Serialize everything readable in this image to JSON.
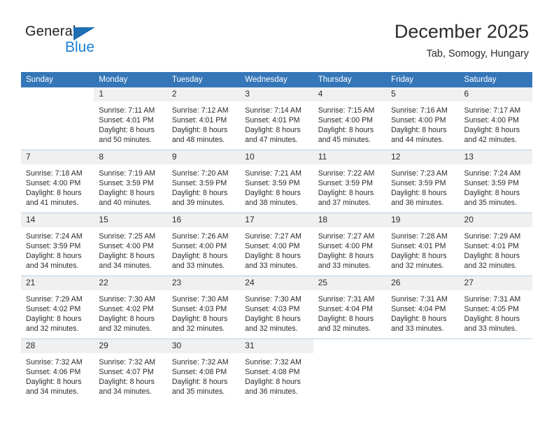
{
  "logo": {
    "word_one": "General",
    "word_two": "Blue",
    "triangle_icon": "blue-triangle-icon",
    "colors": {
      "word_one": "#231f20",
      "word_two": "#1a7fd4",
      "triangle": "#1f6fb5"
    }
  },
  "header": {
    "title": "December 2025",
    "subtitle": "Tab, Somogy, Hungary"
  },
  "theme": {
    "header_row_bg": "#3576b8",
    "header_row_text": "#ffffff",
    "daynum_bg": "#f0f0f0",
    "row_divider": "#b9cde0",
    "body_text": "#2b2b2b"
  },
  "calendar": {
    "weekday_headers": [
      "Sunday",
      "Monday",
      "Tuesday",
      "Wednesday",
      "Thursday",
      "Friday",
      "Saturday"
    ],
    "weeks": [
      [
        {
          "day": "",
          "lines": []
        },
        {
          "day": "1",
          "lines": [
            "Sunrise: 7:11 AM",
            "Sunset: 4:01 PM",
            "Daylight: 8 hours",
            "and 50 minutes."
          ]
        },
        {
          "day": "2",
          "lines": [
            "Sunrise: 7:12 AM",
            "Sunset: 4:01 PM",
            "Daylight: 8 hours",
            "and 48 minutes."
          ]
        },
        {
          "day": "3",
          "lines": [
            "Sunrise: 7:14 AM",
            "Sunset: 4:01 PM",
            "Daylight: 8 hours",
            "and 47 minutes."
          ]
        },
        {
          "day": "4",
          "lines": [
            "Sunrise: 7:15 AM",
            "Sunset: 4:00 PM",
            "Daylight: 8 hours",
            "and 45 minutes."
          ]
        },
        {
          "day": "5",
          "lines": [
            "Sunrise: 7:16 AM",
            "Sunset: 4:00 PM",
            "Daylight: 8 hours",
            "and 44 minutes."
          ]
        },
        {
          "day": "6",
          "lines": [
            "Sunrise: 7:17 AM",
            "Sunset: 4:00 PM",
            "Daylight: 8 hours",
            "and 42 minutes."
          ]
        }
      ],
      [
        {
          "day": "7",
          "lines": [
            "Sunrise: 7:18 AM",
            "Sunset: 4:00 PM",
            "Daylight: 8 hours",
            "and 41 minutes."
          ]
        },
        {
          "day": "8",
          "lines": [
            "Sunrise: 7:19 AM",
            "Sunset: 3:59 PM",
            "Daylight: 8 hours",
            "and 40 minutes."
          ]
        },
        {
          "day": "9",
          "lines": [
            "Sunrise: 7:20 AM",
            "Sunset: 3:59 PM",
            "Daylight: 8 hours",
            "and 39 minutes."
          ]
        },
        {
          "day": "10",
          "lines": [
            "Sunrise: 7:21 AM",
            "Sunset: 3:59 PM",
            "Daylight: 8 hours",
            "and 38 minutes."
          ]
        },
        {
          "day": "11",
          "lines": [
            "Sunrise: 7:22 AM",
            "Sunset: 3:59 PM",
            "Daylight: 8 hours",
            "and 37 minutes."
          ]
        },
        {
          "day": "12",
          "lines": [
            "Sunrise: 7:23 AM",
            "Sunset: 3:59 PM",
            "Daylight: 8 hours",
            "and 36 minutes."
          ]
        },
        {
          "day": "13",
          "lines": [
            "Sunrise: 7:24 AM",
            "Sunset: 3:59 PM",
            "Daylight: 8 hours",
            "and 35 minutes."
          ]
        }
      ],
      [
        {
          "day": "14",
          "lines": [
            "Sunrise: 7:24 AM",
            "Sunset: 3:59 PM",
            "Daylight: 8 hours",
            "and 34 minutes."
          ]
        },
        {
          "day": "15",
          "lines": [
            "Sunrise: 7:25 AM",
            "Sunset: 4:00 PM",
            "Daylight: 8 hours",
            "and 34 minutes."
          ]
        },
        {
          "day": "16",
          "lines": [
            "Sunrise: 7:26 AM",
            "Sunset: 4:00 PM",
            "Daylight: 8 hours",
            "and 33 minutes."
          ]
        },
        {
          "day": "17",
          "lines": [
            "Sunrise: 7:27 AM",
            "Sunset: 4:00 PM",
            "Daylight: 8 hours",
            "and 33 minutes."
          ]
        },
        {
          "day": "18",
          "lines": [
            "Sunrise: 7:27 AM",
            "Sunset: 4:00 PM",
            "Daylight: 8 hours",
            "and 33 minutes."
          ]
        },
        {
          "day": "19",
          "lines": [
            "Sunrise: 7:28 AM",
            "Sunset: 4:01 PM",
            "Daylight: 8 hours",
            "and 32 minutes."
          ]
        },
        {
          "day": "20",
          "lines": [
            "Sunrise: 7:29 AM",
            "Sunset: 4:01 PM",
            "Daylight: 8 hours",
            "and 32 minutes."
          ]
        }
      ],
      [
        {
          "day": "21",
          "lines": [
            "Sunrise: 7:29 AM",
            "Sunset: 4:02 PM",
            "Daylight: 8 hours",
            "and 32 minutes."
          ]
        },
        {
          "day": "22",
          "lines": [
            "Sunrise: 7:30 AM",
            "Sunset: 4:02 PM",
            "Daylight: 8 hours",
            "and 32 minutes."
          ]
        },
        {
          "day": "23",
          "lines": [
            "Sunrise: 7:30 AM",
            "Sunset: 4:03 PM",
            "Daylight: 8 hours",
            "and 32 minutes."
          ]
        },
        {
          "day": "24",
          "lines": [
            "Sunrise: 7:30 AM",
            "Sunset: 4:03 PM",
            "Daylight: 8 hours",
            "and 32 minutes."
          ]
        },
        {
          "day": "25",
          "lines": [
            "Sunrise: 7:31 AM",
            "Sunset: 4:04 PM",
            "Daylight: 8 hours",
            "and 32 minutes."
          ]
        },
        {
          "day": "26",
          "lines": [
            "Sunrise: 7:31 AM",
            "Sunset: 4:04 PM",
            "Daylight: 8 hours",
            "and 33 minutes."
          ]
        },
        {
          "day": "27",
          "lines": [
            "Sunrise: 7:31 AM",
            "Sunset: 4:05 PM",
            "Daylight: 8 hours",
            "and 33 minutes."
          ]
        }
      ],
      [
        {
          "day": "28",
          "lines": [
            "Sunrise: 7:32 AM",
            "Sunset: 4:06 PM",
            "Daylight: 8 hours",
            "and 34 minutes."
          ]
        },
        {
          "day": "29",
          "lines": [
            "Sunrise: 7:32 AM",
            "Sunset: 4:07 PM",
            "Daylight: 8 hours",
            "and 34 minutes."
          ]
        },
        {
          "day": "30",
          "lines": [
            "Sunrise: 7:32 AM",
            "Sunset: 4:08 PM",
            "Daylight: 8 hours",
            "and 35 minutes."
          ]
        },
        {
          "day": "31",
          "lines": [
            "Sunrise: 7:32 AM",
            "Sunset: 4:08 PM",
            "Daylight: 8 hours",
            "and 36 minutes."
          ]
        },
        {
          "day": "",
          "lines": []
        },
        {
          "day": "",
          "lines": []
        },
        {
          "day": "",
          "lines": []
        }
      ]
    ]
  }
}
